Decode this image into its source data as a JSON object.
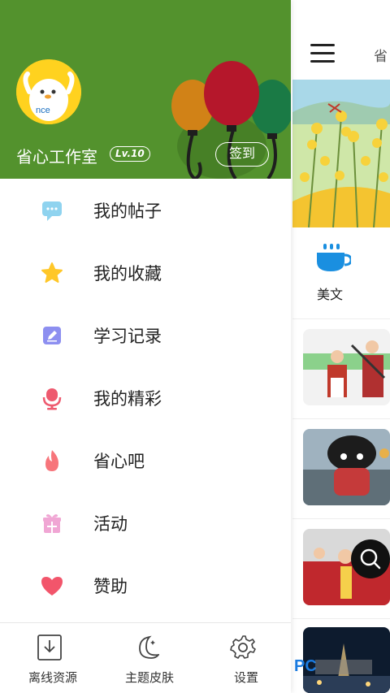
{
  "drawer": {
    "username": "省心工作室",
    "level": "Lv.10",
    "checkin_label": "签到",
    "header_color": "#53922d",
    "avatar_text": "nce",
    "menu": [
      {
        "label": "我的帖子",
        "icon": "chat-bubble-icon",
        "color": "#8fd3ef"
      },
      {
        "label": "我的收藏",
        "icon": "star-icon",
        "color": "#ffc728"
      },
      {
        "label": "学习记录",
        "icon": "edit-note-icon",
        "color": "#8d8ff0"
      },
      {
        "label": "我的精彩",
        "icon": "microphone-icon",
        "color": "#ee5a6f"
      },
      {
        "label": "省心吧",
        "icon": "flame-icon",
        "color": "#f7757b"
      },
      {
        "label": "活动",
        "icon": "gift-icon",
        "color": "#f0a6d4"
      },
      {
        "label": "赞助",
        "icon": "heart-icon",
        "color": "#f2556b"
      }
    ],
    "bottom_tools": [
      {
        "label": "离线资源",
        "icon": "download-box-icon"
      },
      {
        "label": "主题皮肤",
        "icon": "moon-stars-icon"
      },
      {
        "label": "设置",
        "icon": "gear-icon"
      }
    ]
  },
  "background_app": {
    "title_fragment": "省",
    "category_label": "美文",
    "accent": "#1a8fe0"
  },
  "watermark": {
    "text": "PC"
  }
}
